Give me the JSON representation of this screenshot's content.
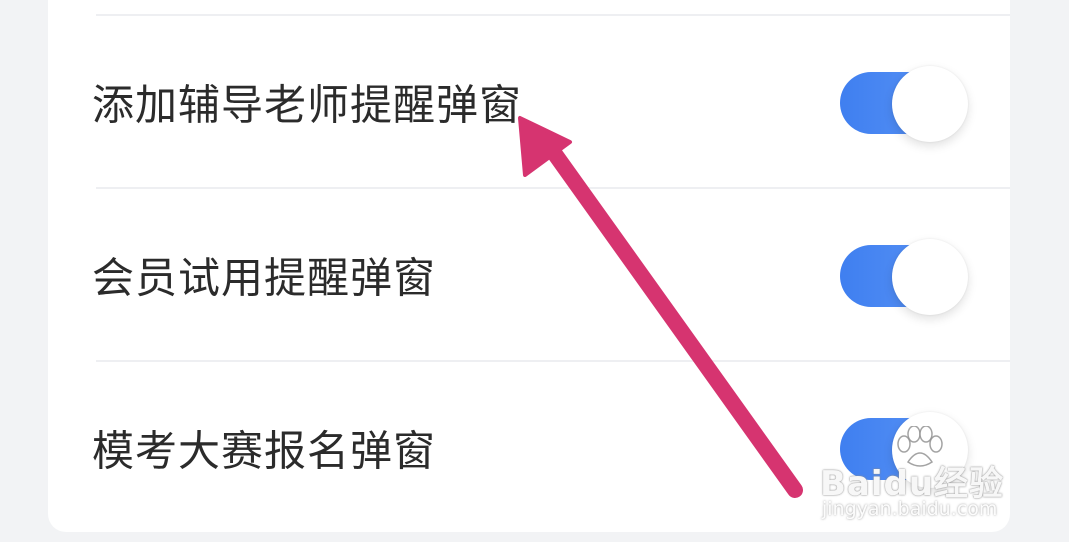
{
  "settings": {
    "items": [
      {
        "label": "添加辅导老师提醒弹窗",
        "enabled": true
      },
      {
        "label": "会员试用提醒弹窗",
        "enabled": true
      },
      {
        "label": "模考大赛报名弹窗",
        "enabled": true
      }
    ]
  },
  "colors": {
    "toggle_on": "#3f7ff0",
    "arrow": "#d63470",
    "background": "#f2f3f5",
    "card": "#ffffff"
  },
  "icons": {
    "toggle_knob": "toggle-knob",
    "annotation_arrow": "arrow-icon",
    "watermark_paw": "baidu-paw-icon"
  },
  "watermark": {
    "brand": "Baidu经验",
    "url": "jingyan.baidu.com"
  }
}
